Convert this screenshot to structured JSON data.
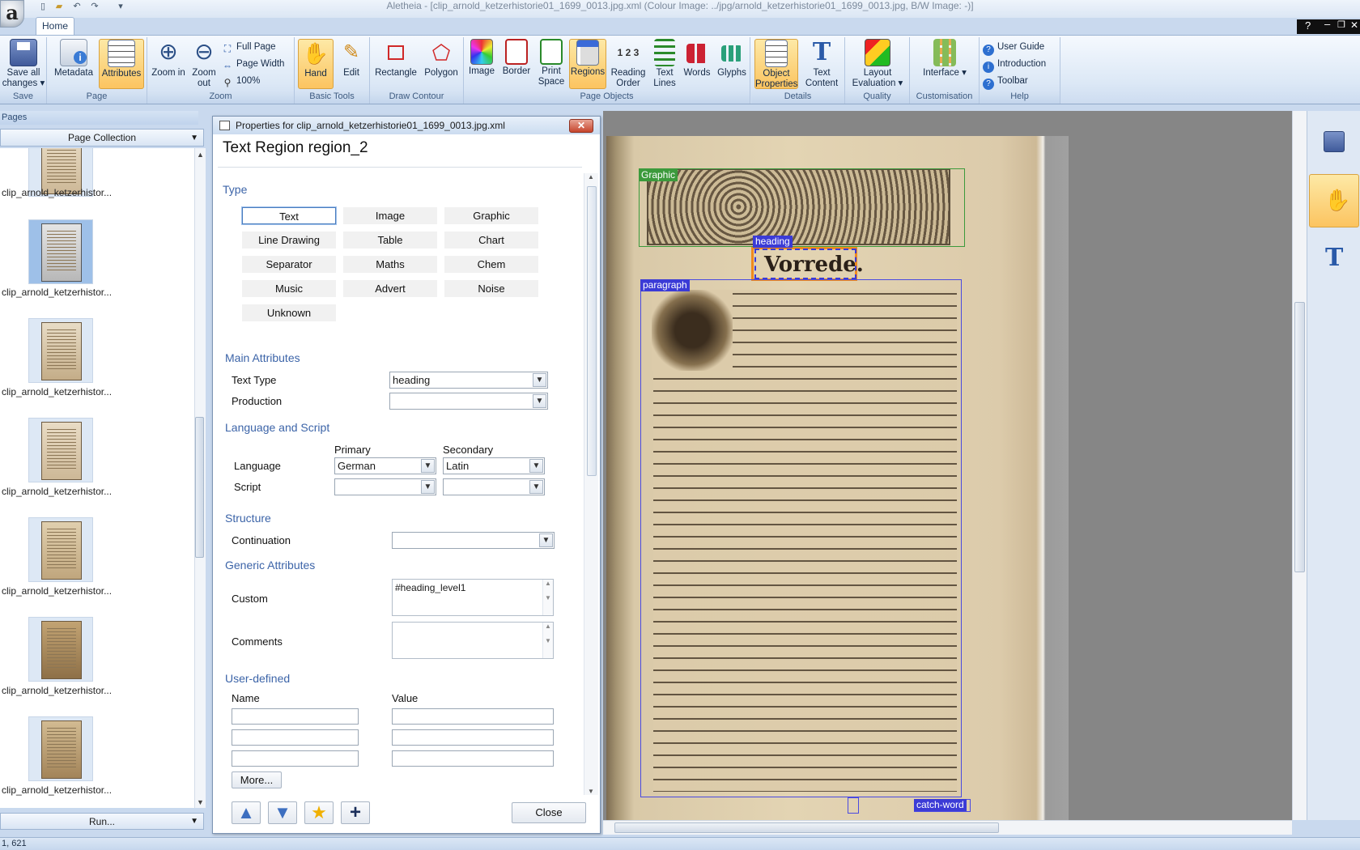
{
  "window": {
    "title": "Aletheia - [clip_arnold_ketzerhistorie01_1699_0013.jpg.xml   (Colour Image: ../jpg/arnold_ketzerhistorie01_1699_0013.jpg,  B/W Image: -)]"
  },
  "app_logo": "a",
  "ribbon": {
    "tab": "Home",
    "groups": {
      "save": {
        "label": "Save",
        "save_all": "Save all changes ▾"
      },
      "page": {
        "label": "Page",
        "metadata": "Metadata",
        "attributes": "Attributes"
      },
      "zoom": {
        "label": "Zoom",
        "zoom_in": "Zoom in",
        "zoom_out": "Zoom out",
        "full_page": "Full Page",
        "page_width": "Page Width",
        "zoom_100": "100%"
      },
      "basic_tools": {
        "label": "Basic Tools",
        "hand": "Hand",
        "edit": "Edit"
      },
      "draw_contour": {
        "label": "Draw Contour",
        "rectangle": "Rectangle",
        "polygon": "Polygon"
      },
      "page_objects": {
        "label": "Page Objects",
        "image": "Image",
        "border": "Border",
        "print_space": "Print Space",
        "regions": "Regions",
        "reading_order": "Reading Order",
        "text_lines": "Text Lines",
        "words": "Words",
        "glyphs": "Glyphs"
      },
      "details": {
        "label": "Details",
        "object_properties": "Object Properties",
        "text_content": "Text Content"
      },
      "quality": {
        "label": "Quality",
        "layout_evaluation": "Layout Evaluation ▾"
      },
      "customisation": {
        "label": "Customisation",
        "interface": "Interface ▾"
      },
      "help": {
        "label": "Help",
        "user_guide": "User Guide",
        "introduction": "Introduction",
        "toolbar": "Toolbar"
      }
    }
  },
  "pages_panel": {
    "header": "Pages",
    "collection": "Page Collection",
    "items": [
      "clip_arnold_ketzerhistor...",
      "clip_arnold_ketzerhistor...",
      "clip_arnold_ketzerhistor...",
      "clip_arnold_ketzerhistor...",
      "clip_arnold_ketzerhistor...",
      "clip_arnold_ketzerhistor...",
      "clip_arnold_ketzerhistor..."
    ],
    "selected_index": 1,
    "run_label": "Run..."
  },
  "dialog": {
    "title": "Properties for clip_arnold_ketzerhistorie01_1699_0013.jpg.xml",
    "close_x": "✕",
    "heading": "Text Region region_2",
    "type_section": "Type",
    "types": [
      [
        "Text",
        "Image",
        "Graphic"
      ],
      [
        "Line Drawing",
        "Table",
        "Chart"
      ],
      [
        "Separator",
        "Maths",
        "Chem"
      ],
      [
        "Music",
        "Advert",
        "Noise"
      ],
      [
        "Unknown"
      ]
    ],
    "selected_type": "Text",
    "main_attributes": {
      "section": "Main Attributes",
      "text_type_label": "Text Type",
      "text_type_value": "heading",
      "production_label": "Production",
      "production_value": ""
    },
    "language_script": {
      "section": "Language and Script",
      "primary_header": "Primary",
      "secondary_header": "Secondary",
      "language_label": "Language",
      "language_primary": "German",
      "language_secondary": "Latin",
      "script_label": "Script",
      "script_primary": "",
      "script_secondary": ""
    },
    "structure": {
      "section": "Structure",
      "continuation_label": "Continuation",
      "continuation_value": ""
    },
    "generic": {
      "section": "Generic Attributes",
      "custom_label": "Custom",
      "custom_value": "#heading_level1",
      "comments_label": "Comments",
      "comments_value": ""
    },
    "user_defined": {
      "section": "User-defined",
      "name_header": "Name",
      "value_header": "Value",
      "more_label": "More..."
    },
    "close_label": "Close"
  },
  "canvas": {
    "regions": {
      "graphic": "Graphic",
      "heading": "heading",
      "paragraph": "paragraph",
      "catchword": "catch-word"
    },
    "heading_text": "Vorrede.",
    "colors": {
      "graphic": "#3c9a3c",
      "text": "#3b3bd6",
      "selected": "#f08a1c"
    }
  },
  "status": {
    "coords": "1, 621"
  }
}
